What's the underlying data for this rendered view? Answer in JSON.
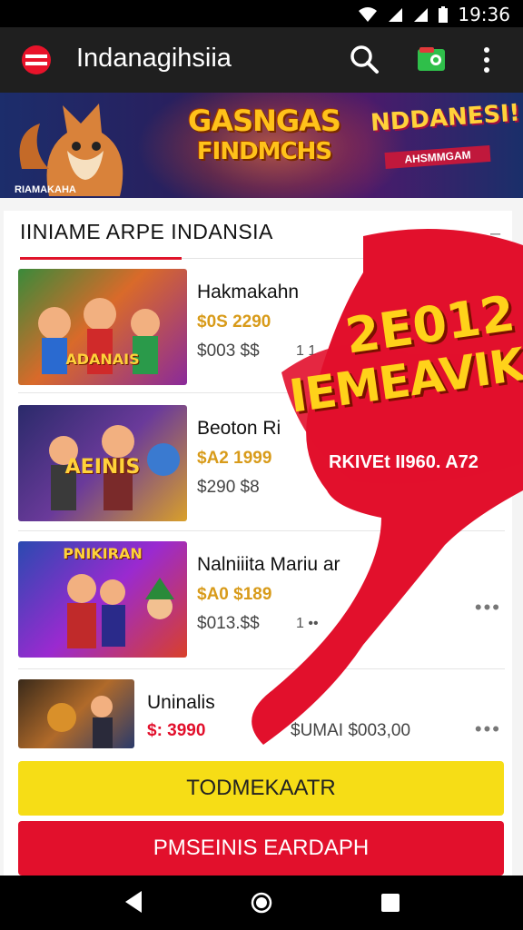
{
  "status_bar": {
    "time": "19:36"
  },
  "app_bar": {
    "title": "Indanagihsiia",
    "actions": {
      "search": "search-icon",
      "wallet": "wallet-icon",
      "more": "more-vert-icon"
    }
  },
  "banner": {
    "headline_line1": "GASNGAS",
    "headline_line2": "FINDMCHS",
    "badge_text": "NDDANESI!",
    "badge_sub": "AHSMMGAM",
    "caption": "RIAMAKAHA"
  },
  "section": {
    "title": "IINIAME ARPE INDANSIA",
    "more": "–"
  },
  "games": [
    {
      "name": "Hakmakahn",
      "price": "$0S 2290",
      "sub": "$003 $$",
      "meta": "1 1",
      "thumb_text": "ADANAIS"
    },
    {
      "name": "Beoton Ri",
      "price": "$A2 1999",
      "sub": "$290 $8",
      "meta": "",
      "thumb_text": "AEINIS"
    },
    {
      "name": "Nalniiita Mariu ar",
      "price": "$A0 $189",
      "sub": "$013.$$",
      "meta": "1 ••",
      "thumb_text": "PNIKIRAN"
    },
    {
      "name": "Uninalis",
      "price": "$: 3990",
      "sub": "$UMAI $003,00",
      "meta": "",
      "thumb_text": ""
    }
  ],
  "promo": {
    "line1": "2E012",
    "line2": "IEMEAVIK",
    "caption": "RKIVEt II960. A72"
  },
  "buttons": {
    "primary": "TODMEKAATR",
    "secondary": "PMSEINIS EARDAPH"
  },
  "colors": {
    "accent_red": "#e2102c",
    "accent_yellow": "#f6dd16",
    "price_gold": "#d89b1a"
  }
}
